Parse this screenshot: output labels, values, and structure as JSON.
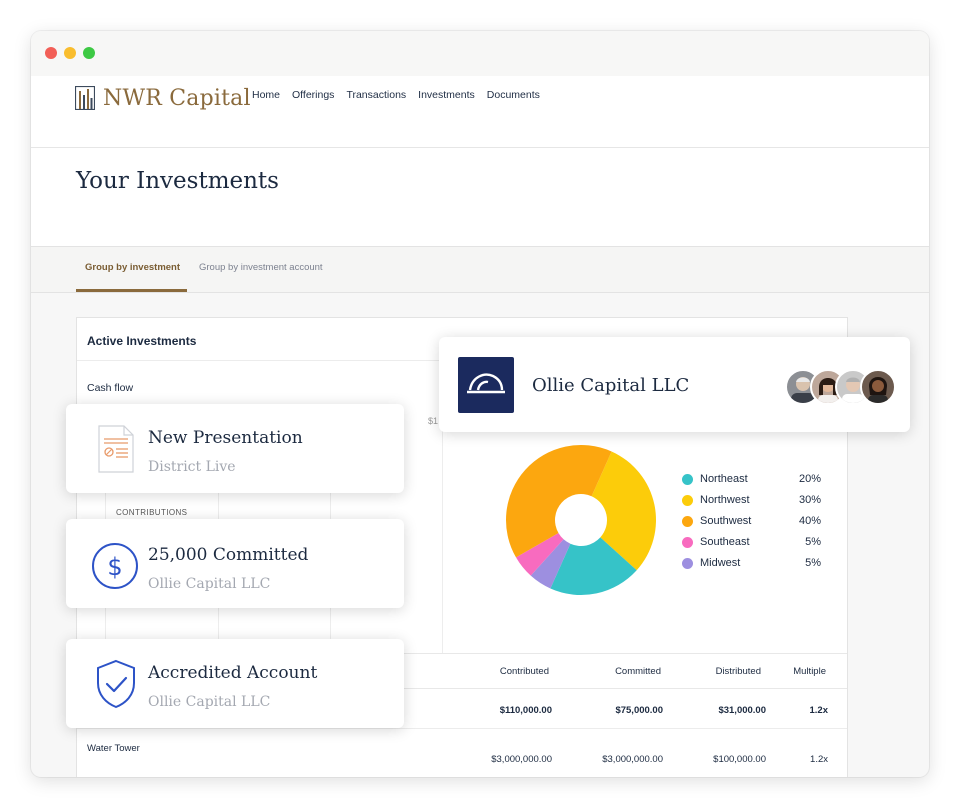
{
  "window": {
    "traffic_lights": [
      "#f25f57",
      "#f9bd2e",
      "#3dc944"
    ]
  },
  "nav": {
    "logo_text": "NWR Capital",
    "links": [
      "Home",
      "Offerings",
      "Transactions",
      "Investments",
      "Documents"
    ]
  },
  "page": {
    "title": "Your Investments"
  },
  "tabs": [
    {
      "label": "Group by investment",
      "active": true
    },
    {
      "label": "Group by investment account",
      "active": false
    }
  ],
  "panel": {
    "title": "Active Investments",
    "cash_flow_label": "Cash flow",
    "axis_fragment": "$1",
    "contributions_label": "CONTRIBUTIONS"
  },
  "table": {
    "headers": [
      "Contributed",
      "Committed",
      "Distributed",
      "Multiple"
    ],
    "rows": [
      {
        "name": "",
        "contributed": "$110,000.00",
        "committed": "$75,000.00",
        "distributed": "$31,000.00",
        "multiple": "1.2x"
      },
      {
        "name": "Water Tower",
        "contributed": "$3,000,000.00",
        "committed": "$3,000,000.00",
        "distributed": "$100,000.00",
        "multiple": "1.2x"
      }
    ]
  },
  "cards": {
    "presentation": {
      "title": "New Presentation",
      "subtitle": "District Live",
      "icon": "document-icon"
    },
    "committed": {
      "title": "25,000 Committed",
      "subtitle": "Ollie Capital LLC",
      "icon": "dollar-icon"
    },
    "accredited": {
      "title": "Accredited Account",
      "subtitle": "Ollie Capital LLC",
      "icon": "shield-check-icon"
    },
    "company": {
      "name": "Ollie Capital LLC",
      "logo_icon": "ollie-logo-icon",
      "brand_color": "#1b2a5e"
    }
  },
  "chart_data": {
    "type": "pie",
    "categories": [
      "Northeast",
      "Northwest",
      "Southwest",
      "Southeast",
      "Midwest"
    ],
    "values": [
      20,
      30,
      40,
      5,
      5
    ],
    "labels": [
      "20%",
      "30%",
      "40%",
      "5%",
      "5%"
    ],
    "colors": [
      "#36c3c8",
      "#fccc0a",
      "#fca70f",
      "#f86bbf",
      "#9d8fe0"
    ],
    "legend": "right"
  }
}
